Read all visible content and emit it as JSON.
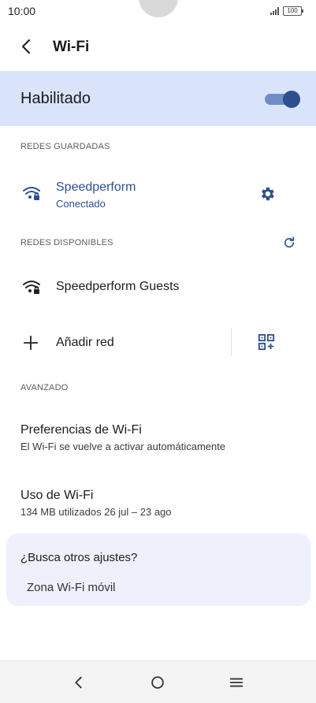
{
  "status_bar": {
    "time": "10:00",
    "battery": "100"
  },
  "app_bar": {
    "title": "Wi-Fi"
  },
  "wifi_toggle": {
    "label": "Habilitado",
    "enabled": true
  },
  "saved_networks": {
    "header": "REDES GUARDADAS",
    "items": [
      {
        "name": "Speedperform",
        "status": "Conectado"
      }
    ]
  },
  "available_networks": {
    "header": "REDES DISPONIBLES",
    "items": [
      {
        "name": "Speedperform Guests"
      }
    ]
  },
  "add_network": {
    "label": "Añadir red"
  },
  "advanced": {
    "header": "AVANZADO",
    "preferences": {
      "title": "Preferencias de Wi-Fi",
      "subtitle": "El Wi-Fi se vuelve a activar automáticamente"
    },
    "usage": {
      "title": "Uso de Wi-Fi",
      "subtitle": "134 MB utilizados 26 jul – 23 ago"
    }
  },
  "search_card": {
    "title": "¿Busca otros ajustes?",
    "link": "Zona Wi-Fi móvil"
  },
  "colors": {
    "accent": "#2d4f8e",
    "toggle_bg": "#d9e4fb",
    "card_bg": "#eef1fb"
  },
  "icons": [
    "back-arrow-icon",
    "wifi-locked-icon",
    "gear-icon",
    "refresh-icon",
    "plus-icon",
    "qr-code-icon",
    "nav-back-icon",
    "nav-home-icon",
    "nav-menu-icon"
  ]
}
